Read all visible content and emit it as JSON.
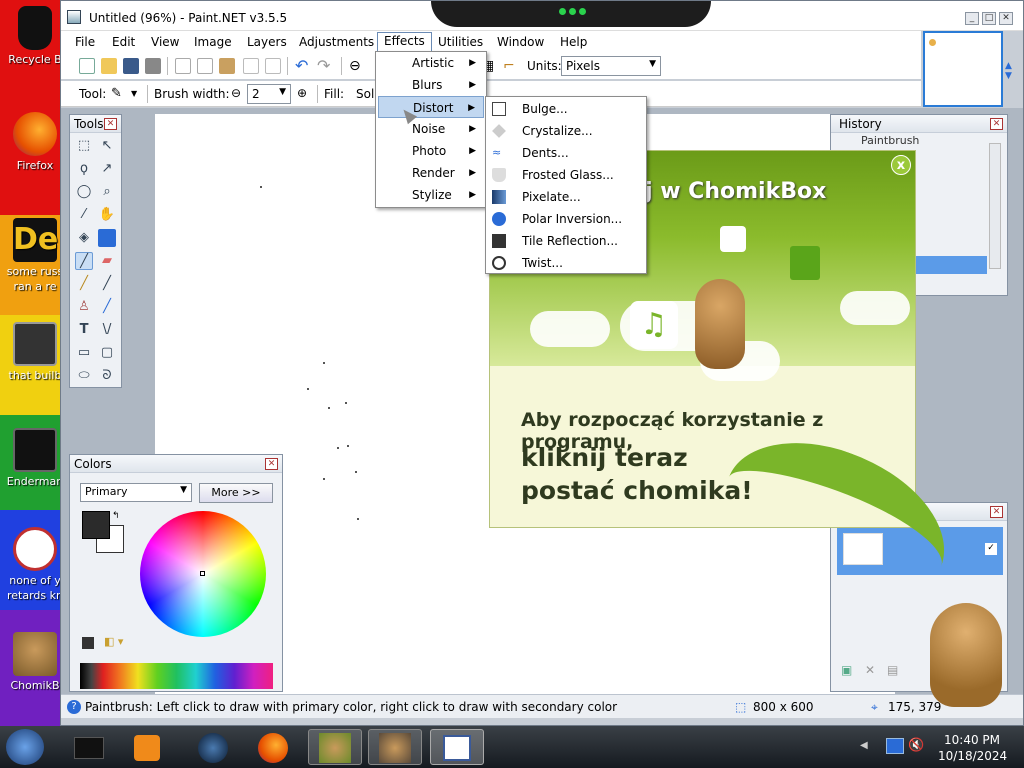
{
  "desktop": {
    "icons": [
      {
        "label": "Recycle Bin",
        "shown": "Recycle B",
        "color": "#202020"
      },
      {
        "label": "Firefox",
        "shown": "Firefox",
        "color": "#e66000"
      },
      {
        "label": "some russ ran a re",
        "shown": "some russ\nran a re",
        "color": "#d8a020"
      },
      {
        "label": "that builb",
        "shown": "that builb",
        "color": "#444"
      },
      {
        "label": "Enderman",
        "shown": "Enderman",
        "color": "#111"
      },
      {
        "label": "none of y retards kn",
        "shown": "none of y\nretards kn",
        "color": "#c03030"
      },
      {
        "label": "ChomikBox",
        "shown": "ChomikB",
        "color": "#7a9e2a"
      }
    ],
    "rainbow": [
      "#e01010",
      "#f07a10",
      "#f0d010",
      "#20a030",
      "#2040e0",
      "#7020c0"
    ]
  },
  "window": {
    "title": "Untitled (96%) - Paint.NET v3.5.5",
    "menus": [
      "File",
      "Edit",
      "View",
      "Image",
      "Layers",
      "Adjustments",
      "Effects",
      "Utilities",
      "Window",
      "Help"
    ],
    "active_menu": "Effects",
    "units_label": "Units:",
    "units_value": "Pixels",
    "tool_label": "Tool:",
    "brush_width_label": "Brush width:",
    "brush_width_value": "2",
    "fill_label": "Fill:",
    "fill_value": "Soli"
  },
  "effects_menu": {
    "items": [
      "Artistic",
      "Blurs",
      "Distort",
      "Noise",
      "Photo",
      "Render",
      "Stylize"
    ],
    "highlighted": "Distort"
  },
  "distort_menu": {
    "items": [
      "Bulge...",
      "Crystalize...",
      "Dents...",
      "Frosted Glass...",
      "Pixelate...",
      "Polar Inversion...",
      "Tile Reflection...",
      "Twist..."
    ]
  },
  "tools_panel": {
    "title": "Tools"
  },
  "colors_panel": {
    "title": "Colors",
    "mode": "Primary",
    "more_button": "More >>"
  },
  "history_panel": {
    "title": "History",
    "item": "Paintbrush"
  },
  "ad": {
    "brand": "j w ChomikBox",
    "line1": "Aby rozpocząć korzystanie z programu,",
    "line2a": "kliknij teraz",
    "line2b": "postać chomika!"
  },
  "status": {
    "hint": "Paintbrush: Left click to draw with primary color, right click to draw with secondary color",
    "size": "800 x 600",
    "coords": "175, 379"
  },
  "taskbar": {
    "time": "10:40 PM",
    "date": "10/18/2024",
    "pinned": [
      "terminal",
      "media-player",
      "globe",
      "firefox",
      "chomikbox",
      "chomikbox-2",
      "paint-net"
    ]
  }
}
